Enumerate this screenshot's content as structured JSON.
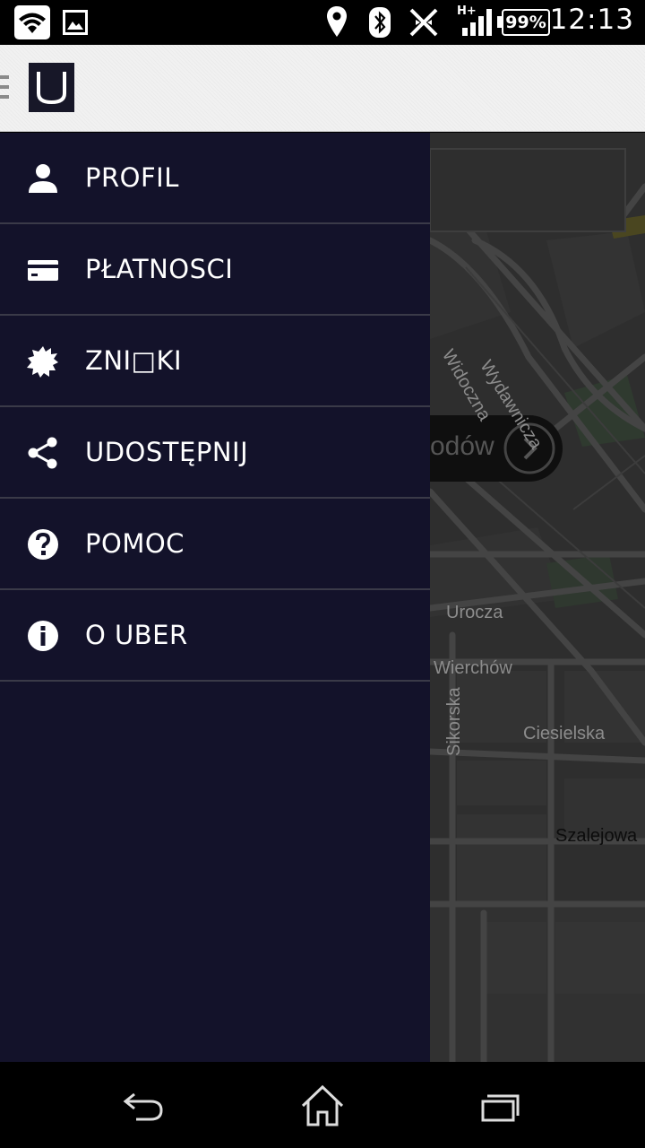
{
  "status_bar": {
    "battery": "99%",
    "time": "12:13",
    "network": "H+",
    "icons": [
      "wifi-icon",
      "image-icon",
      "location-icon",
      "bluetooth-icon",
      "nfc-icon",
      "signal-icon",
      "battery-icon"
    ]
  },
  "action_bar": {
    "icons": [
      "hamburger-icon",
      "uber-logo"
    ]
  },
  "drawer": {
    "items": [
      {
        "label": "PROFIL",
        "icon": "person-icon"
      },
      {
        "label": "PŁATNOSCI",
        "icon": "credit-card-icon"
      },
      {
        "label": "ZNI□KI",
        "icon": "badge-icon"
      },
      {
        "label": "UDOSTĘPNIJ",
        "icon": "share-icon"
      },
      {
        "label": "POMOC",
        "icon": "help-icon"
      },
      {
        "label": "O UBER",
        "icon": "info-icon"
      }
    ]
  },
  "map": {
    "labels": {
      "wydawnicza": "Wydawnicza",
      "widoczna": "Widoczna",
      "pill": "odów",
      "urocza": "Urocza",
      "wierchow": "Wierchów",
      "sikorska": "Sikorska",
      "ciesielska": "Ciesielska",
      "szalejowa": "Szalejowa"
    }
  },
  "colors": {
    "drawer_bg": "#13122a",
    "divider": "#3a3a48",
    "map_bg": "#2f2f2f",
    "action_bar_bg": "#f1f1f1"
  },
  "nav_bar": {
    "icons": [
      "back-icon",
      "home-icon",
      "recents-icon"
    ]
  }
}
